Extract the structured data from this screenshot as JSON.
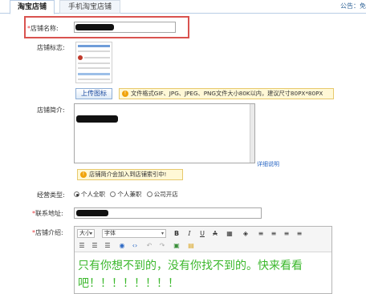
{
  "tabs": [
    {
      "label": "淘宝店铺",
      "active": true
    },
    {
      "label": "手机淘宝店铺",
      "active": false
    }
  ],
  "notice": "公告：免",
  "form": {
    "shop_name_label": "店铺名称:",
    "shop_logo_label": "店铺标志:",
    "upload_button": "上传图标",
    "logo_tip": "文件格式GIF、JPG、JPEG、PNG文件大小80K以内，建议尺寸80PX*80PX",
    "intro_label": "店铺简介:",
    "detail_link": "详细说明",
    "intro_tip": "店铺简介会加入到店铺索引中!",
    "business_type_label": "经营类型:",
    "business_options": [
      {
        "label": "个人全职",
        "checked": true
      },
      {
        "label": "个人兼职",
        "checked": false
      },
      {
        "label": "公司开店",
        "checked": false
      }
    ],
    "contact_label": "联系地址:",
    "shop_desc_label": "店铺介绍:",
    "required_mark": "*"
  },
  "editor": {
    "font_size_select": "大小",
    "font_family_select": "字体",
    "toolbar_row1": [
      "B",
      "I",
      "U",
      "A",
      "▦",
      "◈",
      "≡",
      "≡",
      "≡",
      "≡"
    ],
    "toolbar_row2": [
      "☰",
      "☰",
      "☰",
      "◉",
      "‹›",
      "↶",
      "↷",
      "▣",
      "▤"
    ],
    "content": "只有你想不到的，没有你找不到的。快来看看吧！！！！！！！！"
  },
  "colors": {
    "required": "#e4393c",
    "highlight_box": "#d9534f",
    "editor_text": "#3cb82d",
    "link": "#2a67c4"
  }
}
